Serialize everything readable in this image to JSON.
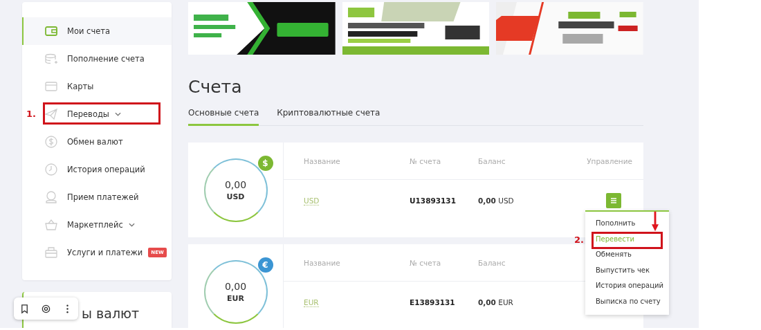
{
  "sidebar": {
    "items": [
      {
        "label": "Мои счета",
        "selected": true,
        "expandable": false
      },
      {
        "label": "Пополнение счета",
        "selected": false,
        "expandable": false
      },
      {
        "label": "Карты",
        "selected": false,
        "expandable": false
      },
      {
        "label": "Переводы",
        "selected": false,
        "expandable": true
      },
      {
        "label": "Обмен валют",
        "selected": false,
        "expandable": false
      },
      {
        "label": "История операций",
        "selected": false,
        "expandable": false
      },
      {
        "label": "Прием платежей",
        "selected": false,
        "expandable": false
      },
      {
        "label": "Маркетплейс",
        "selected": false,
        "expandable": true
      },
      {
        "label": "Услуги и платежи",
        "selected": false,
        "expandable": false,
        "badge": "NEW"
      }
    ]
  },
  "rates_card": {
    "title": "ы валют"
  },
  "page_title": "Счета",
  "tabs": [
    {
      "label": "Основные счета",
      "selected": true
    },
    {
      "label": "Криптовалютные счета",
      "selected": false
    }
  ],
  "accounts": [
    {
      "amount": "0,00",
      "currency": "USD",
      "symbol": "$",
      "color": "#7cb832",
      "columns": [
        "Название",
        "№ счета",
        "Баланс",
        "Управление"
      ],
      "name": "USD",
      "number": "U13893131",
      "balance_amount": "0,00",
      "balance_currency": "USD",
      "menu_open": true
    },
    {
      "amount": "0,00",
      "currency": "EUR",
      "symbol": "€",
      "color": "#3b95d3",
      "columns": [
        "Название",
        "№ счета",
        "Баланс"
      ],
      "name": "EUR",
      "number": "E13893131",
      "balance_amount": "0,00",
      "balance_currency": "EUR",
      "menu_open": false
    }
  ],
  "account_menu": {
    "items": [
      {
        "label": "Пополнить",
        "selected": false
      },
      {
        "label": "Перевести",
        "selected": true
      },
      {
        "label": "Обменять",
        "selected": false
      },
      {
        "label": "Выпустить чек",
        "selected": false
      },
      {
        "label": "История операций",
        "selected": false
      },
      {
        "label": "Выписка по счету",
        "selected": false
      }
    ]
  },
  "annotations": [
    {
      "label": "1."
    },
    {
      "label": "2."
    }
  ]
}
